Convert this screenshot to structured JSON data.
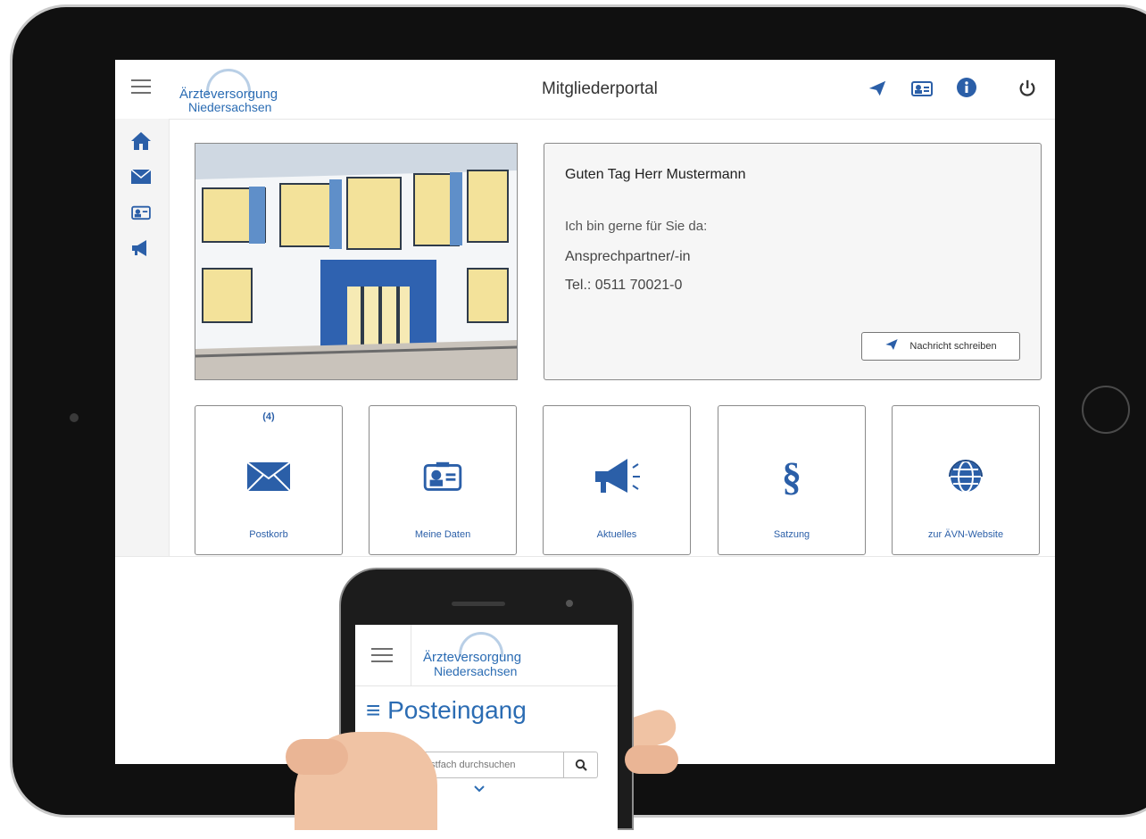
{
  "header": {
    "logo_line1": "Ärzteversorgung",
    "logo_line2": "Niedersachsen",
    "title": "Mitgliederportal"
  },
  "top_icons": [
    "paper-plane-icon",
    "id-card-icon",
    "info-icon",
    "power-icon"
  ],
  "sidebar_icons": [
    "home-icon",
    "envelope-icon",
    "id-card-icon",
    "megaphone-icon"
  ],
  "greeting": {
    "title": "Guten Tag Herr Mustermann",
    "line1": "Ich bin gerne für Sie da:",
    "line2": "Ansprechpartner/-in",
    "line3": "Tel.: 0511 70021-0",
    "button": "Nachricht schreiben"
  },
  "tiles": [
    {
      "label": "Postkorb",
      "badge": "(4)",
      "icon": "envelope-icon"
    },
    {
      "label": "Meine Daten",
      "badge": "",
      "icon": "id-card-icon"
    },
    {
      "label": "Aktuelles",
      "badge": "",
      "icon": "megaphone-icon"
    },
    {
      "label": "Satzung",
      "badge": "",
      "icon": "paragraph-icon"
    },
    {
      "label": "zur ÄVN-Website",
      "badge": "",
      "icon": "globe-icon"
    }
  ],
  "phone": {
    "logo_line1": "Ärzteversorgung",
    "logo_line2": "Niedersachsen",
    "heading": "≡ Posteingang",
    "search_placeholder": "Aktuelles Postfach durchsuchen"
  },
  "colors": {
    "accent": "#2b5fa8",
    "logo": "#2b6cb3"
  }
}
